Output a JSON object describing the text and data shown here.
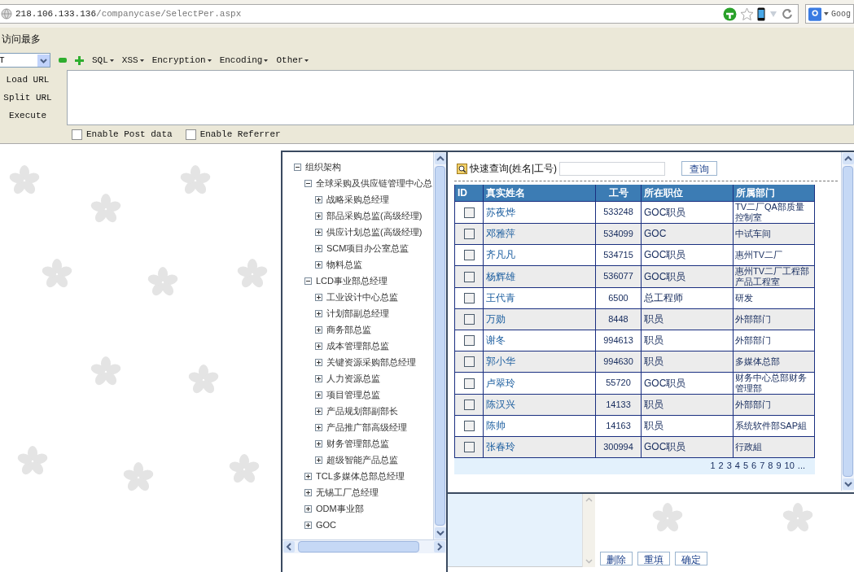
{
  "address_bar": {
    "host": "218.106.133.136",
    "path": "/companycase/SelectPer.aspx"
  },
  "search_engine": {
    "label": "Goog"
  },
  "bookmarks": [
    "访问最多"
  ],
  "hackbar": {
    "select_value": "T",
    "menus": [
      "SQL",
      "XSS",
      "Encryption",
      "Encoding",
      "Other"
    ],
    "actions": [
      "Load URL",
      "Split URL",
      "Execute"
    ],
    "options": [
      {
        "label": "Enable Post data",
        "checked": false
      },
      {
        "label": "Enable Referrer",
        "checked": false
      }
    ]
  },
  "tree": [
    {
      "label": "组织架构",
      "expanded": true,
      "children": [
        {
          "label": "全球采购及供应链管理中心总",
          "expanded": true,
          "children": [
            {
              "label": "战略采购总经理",
              "expanded": false
            },
            {
              "label": "部品采购总监(高级经理)",
              "expanded": false
            },
            {
              "label": "供应计划总监(高级经理)",
              "expanded": false
            },
            {
              "label": "SCM项目办公室总监",
              "expanded": false
            },
            {
              "label": "物料总监",
              "expanded": false
            }
          ]
        },
        {
          "label": "LCD事业部总经理",
          "expanded": true,
          "children": [
            {
              "label": "工业设计中心总监",
              "expanded": false
            },
            {
              "label": "计划部副总经理",
              "expanded": false
            },
            {
              "label": "商务部总监",
              "expanded": false
            },
            {
              "label": "成本管理部总监",
              "expanded": false
            },
            {
              "label": "关键资源采购部总经理",
              "expanded": false
            },
            {
              "label": "人力资源总监",
              "expanded": false
            },
            {
              "label": "项目管理总监",
              "expanded": false
            },
            {
              "label": "产品规划部副部长",
              "expanded": false
            },
            {
              "label": "产品推广部高级经理",
              "expanded": false
            },
            {
              "label": "财务管理部总监",
              "expanded": false
            },
            {
              "label": "超级智能产品总监",
              "expanded": false
            }
          ]
        },
        {
          "label": "TCL多媒体总部总经理",
          "expanded": false
        },
        {
          "label": "无锡工厂总经理",
          "expanded": false
        },
        {
          "label": "ODM事业部",
          "expanded": false
        },
        {
          "label": "GOC",
          "expanded": false
        }
      ]
    }
  ],
  "quick_search": {
    "label": "快速查询(姓名|工号)",
    "button": "查询"
  },
  "table": {
    "columns": [
      "ID",
      "真实姓名",
      "工号",
      "所在职位",
      "所属部门"
    ],
    "rows": [
      {
        "checked": false,
        "name": "苏夜烨",
        "number": "533248",
        "position": "GOC职员",
        "department": "TV二厂QA部质量控制室"
      },
      {
        "checked": false,
        "name": "邓雅萍",
        "number": "534099",
        "position": "GOC",
        "department": "中试车间"
      },
      {
        "checked": false,
        "name": "齐凡凡",
        "number": "534715",
        "position": "GOC职员",
        "department": "惠州TV二厂"
      },
      {
        "checked": false,
        "name": "杨辉雄",
        "number": "536077",
        "position": "GOC职员",
        "department": "惠州TV二厂工程部产品工程室"
      },
      {
        "checked": false,
        "name": "王代青",
        "number": "6500",
        "position": "总工程师",
        "department": "研发"
      },
      {
        "checked": false,
        "name": "万勋",
        "number": "8448",
        "position": "职员",
        "department": "外部部门"
      },
      {
        "checked": false,
        "name": "谢冬",
        "number": "994613",
        "position": "职员",
        "department": "外部部门"
      },
      {
        "checked": false,
        "name": "郭小华",
        "number": "994630",
        "position": "职员",
        "department": "多媒体总部"
      },
      {
        "checked": false,
        "name": "卢翠玲",
        "number": "55720",
        "position": "GOC职员",
        "department": "财务中心总部财务管理部"
      },
      {
        "checked": false,
        "name": "陈汉兴",
        "number": "14133",
        "position": "职员",
        "department": "外部部门"
      },
      {
        "checked": false,
        "name": "陈帅",
        "number": "14163",
        "position": "职员",
        "department": "系统软件部SAP組"
      },
      {
        "checked": false,
        "name": "张春玲",
        "number": "300994",
        "position": "GOC职员",
        "department": "行政組"
      }
    ],
    "pages": [
      "1",
      "2",
      "3",
      "4",
      "5",
      "6",
      "7",
      "8",
      "9",
      "10",
      "..."
    ]
  },
  "actions": [
    "删除",
    "重填",
    "确定"
  ]
}
